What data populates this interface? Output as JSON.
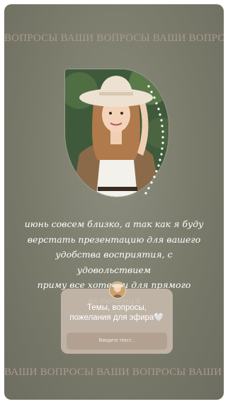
{
  "ticker": {
    "top": "ВОПРОСЫ ВАШИ ВОПРОСЫ ВАШИ ВОПРОСЫ ВАШИ",
    "bottom": "ВАШИ ВОПРОСЫ ВАШИ ВОПРОСЫ ВАШИ ВОПРОСЫ"
  },
  "photo": {
    "description_icon": "portrait-photo"
  },
  "caption": {
    "line1": "июнь совсем близко, а так как я буду",
    "line2": "верстать презентацию для вашего",
    "line3": "удобства восприятия, с удовольствием",
    "line4": "приму все хотелки для прямого включения"
  },
  "question_box": {
    "title": "Темы, вопросы, пожелания для эфира🤍",
    "placeholder": "Введите текст..."
  },
  "colors": {
    "background": "#7a7a6b",
    "ticker_text": "#a89a8b",
    "question_box": "#c6b9ac"
  }
}
